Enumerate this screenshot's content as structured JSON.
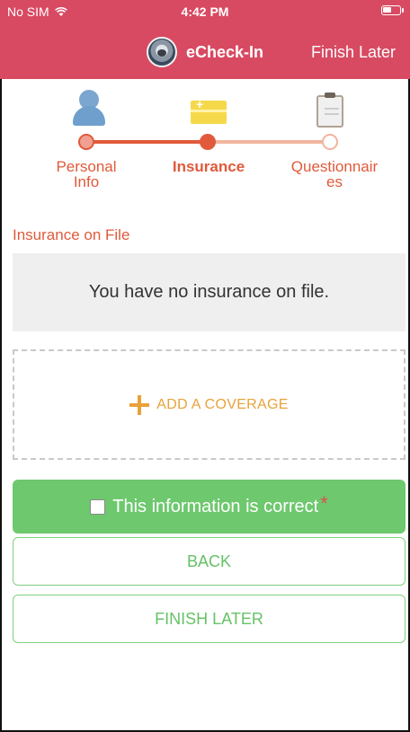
{
  "status_bar": {
    "carrier": "No SIM",
    "time": "4:42 PM"
  },
  "navbar": {
    "title": "eCheck-In",
    "finish_later": "Finish Later"
  },
  "stepper": {
    "steps": [
      {
        "label": "Personal Info",
        "icon": "person-icon",
        "state": "completed"
      },
      {
        "label": "Insurance",
        "icon": "insurance-card-icon",
        "state": "current"
      },
      {
        "label": "Questionnaires",
        "icon": "clipboard-icon",
        "state": "upcoming"
      }
    ],
    "label_lines": [
      [
        "Personal",
        "Info"
      ],
      [
        "Insurance"
      ],
      [
        "Questionnair",
        "es"
      ]
    ]
  },
  "insurance": {
    "section_title": "Insurance on File",
    "empty_message": "You have no insurance on file.",
    "add_coverage": "ADD A COVERAGE"
  },
  "confirm": {
    "label": "This information is correct",
    "required_mark": "*",
    "checked": false
  },
  "buttons": {
    "back": "BACK",
    "finish_later": "FINISH LATER"
  },
  "colors": {
    "header": "#d84a62",
    "accent": "#e05a3b",
    "add": "#e8a23a",
    "confirm": "#6ec86e"
  }
}
